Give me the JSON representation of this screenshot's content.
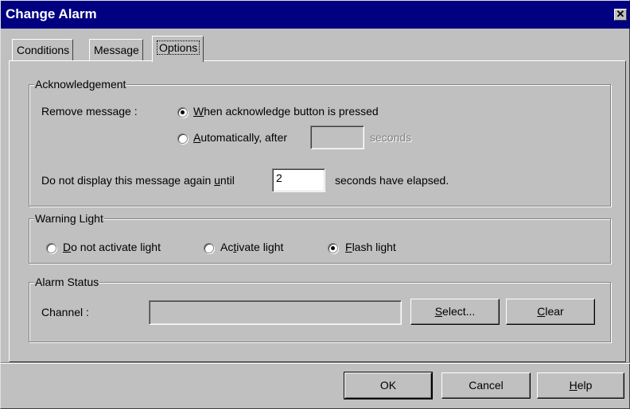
{
  "window": {
    "title": "Change Alarm",
    "close_glyph": "✕"
  },
  "tabs": [
    {
      "label": "Conditions"
    },
    {
      "label": "Message"
    },
    {
      "label": "Options",
      "active": true
    }
  ],
  "acknowledgement": {
    "group_label": "Acknowledgement",
    "remove_label": "Remove message :",
    "option_pressed_pre": "W",
    "option_pressed_rest": "hen acknowledge button is pressed",
    "option_auto_pre": "A",
    "option_auto_rest": "utomatically, after",
    "auto_seconds_value": "",
    "seconds_label": "seconds",
    "selected": "pressed",
    "repeat_label_pre": "Do not display this message again ",
    "repeat_label_u": "u",
    "repeat_label_rest": "ntil",
    "repeat_value": "2",
    "elapsed_label": "seconds have elapsed."
  },
  "warning_light": {
    "group_label": "Warning Light",
    "opt1_pre": "D",
    "opt1_rest": "o not activate light",
    "opt2_pre": "Ac",
    "opt2_u": "t",
    "opt2_rest": "ivate light",
    "opt3_pre": "F",
    "opt3_rest": "lash light",
    "selected": "flash"
  },
  "alarm_status": {
    "group_label": "Alarm Status",
    "channel_label": "Channel :",
    "channel_value": "",
    "select_pre": "S",
    "select_rest": "elect...",
    "clear_pre": "C",
    "clear_rest": "lear"
  },
  "footer": {
    "ok_label": "OK",
    "cancel_label": "Cancel",
    "help_pre": "H",
    "help_rest": "elp"
  },
  "colors": {
    "titlebar": "#000080",
    "face": "#c0c0c0"
  }
}
